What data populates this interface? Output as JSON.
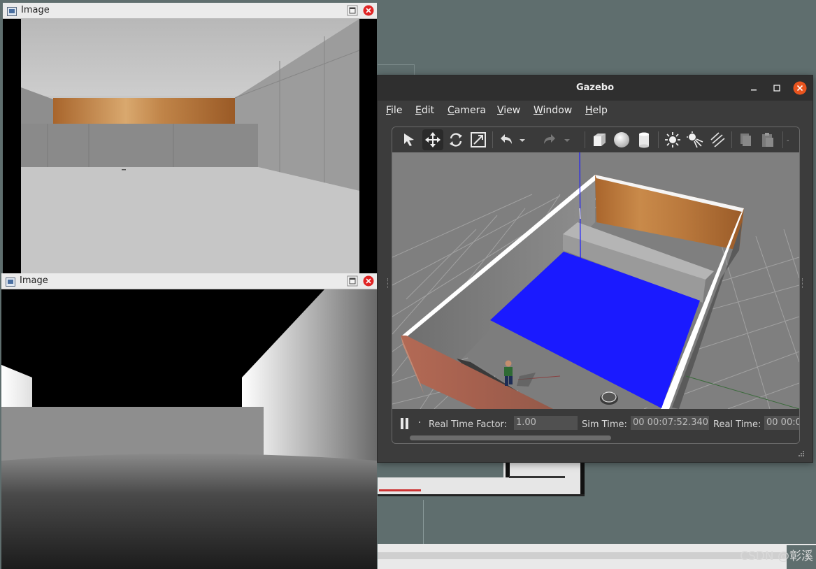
{
  "image_window_rgb": {
    "title": "Image"
  },
  "image_window_depth": {
    "title": "Image"
  },
  "gazebo": {
    "title": "Gazebo",
    "menu": [
      {
        "label": "File",
        "mnemonic": "F",
        "rest": "ile"
      },
      {
        "label": "Edit",
        "mnemonic": "E",
        "rest": "dit"
      },
      {
        "label": "Camera",
        "mnemonic": "C",
        "rest": "amera"
      },
      {
        "label": "View",
        "mnemonic": "V",
        "rest": "iew"
      },
      {
        "label": "Window",
        "mnemonic": "W",
        "rest": "indow"
      },
      {
        "label": "Help",
        "mnemonic": "H",
        "rest": "elp"
      }
    ],
    "toolbar_icons": [
      "select-arrow-icon",
      "translate-icon",
      "rotate-icon",
      "scale-icon",
      "undo-icon",
      "redo-icon",
      "box-icon",
      "sphere-icon",
      "cylinder-icon",
      "point-light-icon",
      "spot-light-icon",
      "directional-light-icon",
      "copy-icon",
      "paste-icon"
    ],
    "status": {
      "real_time_factor_label": "Real Time Factor:",
      "real_time_factor_value": "1.00",
      "sim_time_label": "Sim Time:",
      "sim_time_value": "00 00:07:52.340",
      "real_time_label": "Real Time:",
      "real_time_value": "00 00:0"
    },
    "colors": {
      "floor_plane": "#1a1aff",
      "accent_close": "#e9541e"
    }
  },
  "watermark": "CSDN @彰溪"
}
